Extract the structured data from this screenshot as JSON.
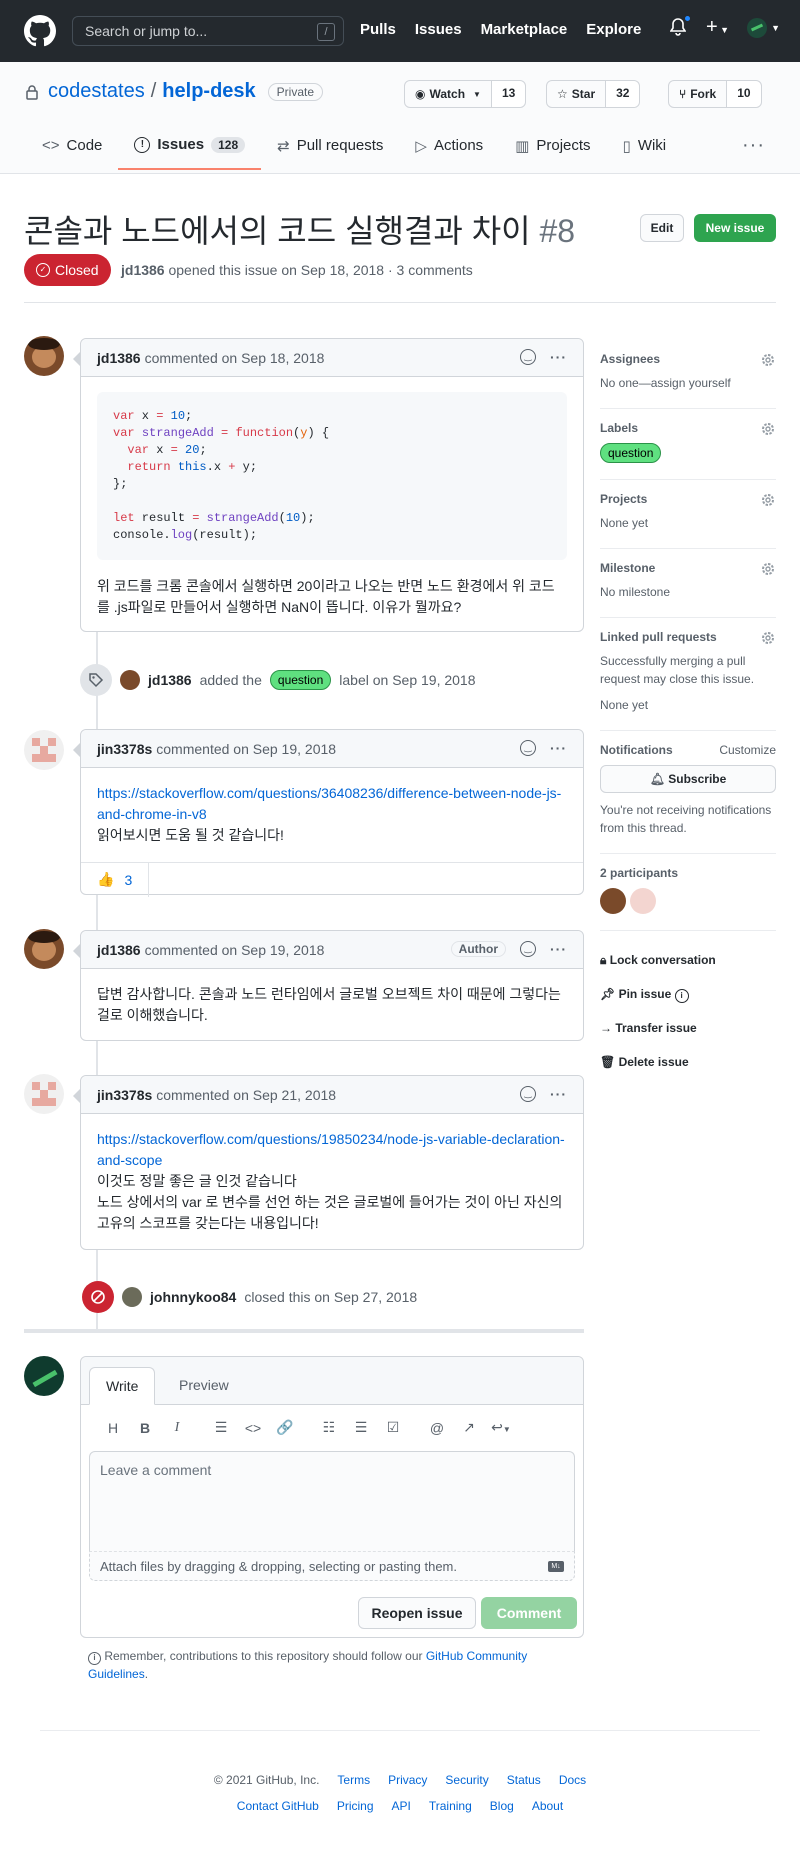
{
  "header": {
    "search_placeholder": "Search or jump to...",
    "slash_key": "/",
    "nav": [
      "Pulls",
      "Issues",
      "Marketplace",
      "Explore"
    ]
  },
  "repo": {
    "owner": "codestates",
    "separator": "/",
    "name": "help-desk",
    "visibility": "Private",
    "watch_label": "Watch",
    "watch_count": "13",
    "star_label": "Star",
    "star_count": "32",
    "fork_label": "Fork",
    "fork_count": "10",
    "tabs": [
      {
        "label": "Code"
      },
      {
        "label": "Issues",
        "count": "128"
      },
      {
        "label": "Pull requests"
      },
      {
        "label": "Actions"
      },
      {
        "label": "Projects"
      },
      {
        "label": "Wiki"
      }
    ]
  },
  "issue": {
    "title": "콘솔과 노드에서의 코드 실행결과 차이",
    "number": "#8",
    "edit_label": "Edit",
    "new_issue_label": "New issue",
    "state": "Closed",
    "author": "jd1386",
    "meta_text": "opened this issue on Sep 18, 2018 · 3 comments"
  },
  "comments": [
    {
      "author": "jd1386",
      "date": "commented on Sep 18, 2018",
      "code": [
        "var x = 10;",
        "var strangeAdd = function(y) {",
        "  var x = 20;",
        "  return this.x + y;",
        "};",
        "",
        "let result = strangeAdd(10);",
        "console.log(result);"
      ],
      "text": "위 코드를 크롬 콘솔에서 실행하면 20이라고 나오는 반면 노드 환경에서 위 코드를 .js파일로 만들어서 실행하면 NaN이 뜹니다. 이유가 뭘까요?"
    },
    {
      "author": "jin3378s",
      "date": "commented on Sep 19, 2018",
      "link": "https://stackoverflow.com/questions/36408236/difference-between-node-js-and-chrome-in-v8",
      "text": "읽어보시면 도움 될 것 같습니다!",
      "reaction_emoji": "👍",
      "reaction_count": "3"
    },
    {
      "author": "jd1386",
      "date": "commented on Sep 19, 2018",
      "role": "Author",
      "text": "답변 감사합니다. 콘솔과 노드 런타임에서 글로벌 오브젝트 차이 때문에 그렇다는 걸로 이해했습니다."
    },
    {
      "author": "jin3378s",
      "date": "commented on Sep 21, 2018",
      "link": "https://stackoverflow.com/questions/19850234/node-js-variable-declaration-and-scope",
      "text1": "이것도 정말 좋은 글 인것 같습니다",
      "text2": "노드 상에서의 var 로 변수를 선언 하는 것은 글로벌에 들어가는 것이 아닌 자신의 고유의 스코프를 갖는다는 내용입니다!"
    }
  ],
  "events": {
    "label_event": {
      "actor": "jd1386",
      "pre": "added the",
      "label": "question",
      "post": "label on Sep 19, 2018"
    },
    "close_event": {
      "actor": "johnnykoo84",
      "text": "closed this on Sep 27, 2018"
    }
  },
  "sidebar": {
    "assignees_h": "Assignees",
    "assignees_t": "No one—assign yourself",
    "labels_h": "Labels",
    "label": "question",
    "projects_h": "Projects",
    "projects_t": "None yet",
    "milestone_h": "Milestone",
    "milestone_t": "No milestone",
    "linked_h": "Linked pull requests",
    "linked_t": "Successfully merging a pull request may close this issue.",
    "linked_t2": "None yet",
    "notif_h": "Notifications",
    "notif_customize": "Customize",
    "subscribe": "Subscribe",
    "notif_t": "You're not receiving notifications from this thread.",
    "participants_h": "2 participants",
    "lock": "Lock conversation",
    "pin": "Pin issue",
    "transfer": "Transfer issue",
    "delete": "Delete issue"
  },
  "composer": {
    "write": "Write",
    "preview": "Preview",
    "placeholder": "Leave a comment",
    "attach": "Attach files by dragging & dropping, selecting or pasting them.",
    "reopen": "Reopen issue",
    "comment": "Comment",
    "remember_pre": "Remember, contributions to this repository should follow our",
    "remember_link": "GitHub Community Guidelines",
    "remember_post": "."
  },
  "footer": {
    "copyright": "© 2021 GitHub, Inc.",
    "row1": [
      "Terms",
      "Privacy",
      "Security",
      "Status",
      "Docs"
    ],
    "row2": [
      "Contact GitHub",
      "Pricing",
      "API",
      "Training",
      "Blog",
      "About"
    ]
  },
  "colors": {
    "header_bg": "#24292e",
    "closed_red": "#cb2431",
    "green": "#2ea44f",
    "link": "#0366d6",
    "label_bg": "#5fe080"
  }
}
